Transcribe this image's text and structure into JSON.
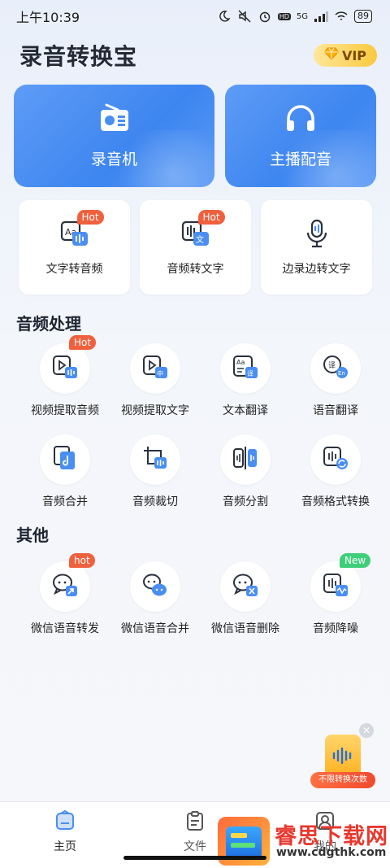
{
  "status_bar": {
    "time": "上午10:39",
    "network": "5G",
    "battery": "89",
    "hd": "HD"
  },
  "header": {
    "title": "录音转换宝",
    "vip_label": "VIP"
  },
  "big_cards": [
    {
      "label": "录音机",
      "icon": "radio-icon"
    },
    {
      "label": "主播配音",
      "icon": "headphones-icon"
    }
  ],
  "small_cards": [
    {
      "label": "文字转音频",
      "badge": "Hot",
      "icon": "text-to-audio-icon"
    },
    {
      "label": "音频转文字",
      "badge": "Hot",
      "icon": "audio-to-text-icon"
    },
    {
      "label": "边录边转文字",
      "icon": "microphone-icon"
    }
  ],
  "sections": {
    "audio": {
      "title": "音频处理",
      "items": [
        {
          "label": "视频提取音频",
          "badge": "Hot",
          "icon": "video-extract-audio-icon"
        },
        {
          "label": "视频提取文字",
          "icon": "video-extract-text-icon"
        },
        {
          "label": "文本翻译",
          "icon": "text-translate-icon"
        },
        {
          "label": "语音翻译",
          "icon": "voice-translate-icon"
        },
        {
          "label": "音频合并",
          "icon": "audio-merge-icon"
        },
        {
          "label": "音频裁切",
          "icon": "audio-crop-icon"
        },
        {
          "label": "音频分割",
          "icon": "audio-split-icon"
        },
        {
          "label": "音频格式转换",
          "icon": "audio-format-icon"
        }
      ]
    },
    "other": {
      "title": "其他",
      "items": [
        {
          "label": "微信语音转发",
          "badge": "hot",
          "icon": "wechat-forward-icon"
        },
        {
          "label": "微信语音合并",
          "icon": "wechat-merge-icon"
        },
        {
          "label": "微信语音删除",
          "icon": "wechat-delete-icon"
        },
        {
          "label": "音频降噪",
          "badge": "New",
          "icon": "audio-denoise-icon"
        }
      ]
    }
  },
  "promo": {
    "label": "不限转换次数"
  },
  "bottom_nav": [
    {
      "label": "主页",
      "icon": "home-icon",
      "active": true
    },
    {
      "label": "文件",
      "icon": "clipboard-icon"
    },
    {
      "label": "我的",
      "icon": "user-icon"
    }
  ],
  "watermark": {
    "name": "睿思下载网",
    "url": "www.cdgthk.com"
  },
  "colors": {
    "accent": "#3d85f0",
    "hot_badge": "#f0603c",
    "new_badge": "#3fcf7a",
    "vip_gold": "#f9c93e"
  }
}
